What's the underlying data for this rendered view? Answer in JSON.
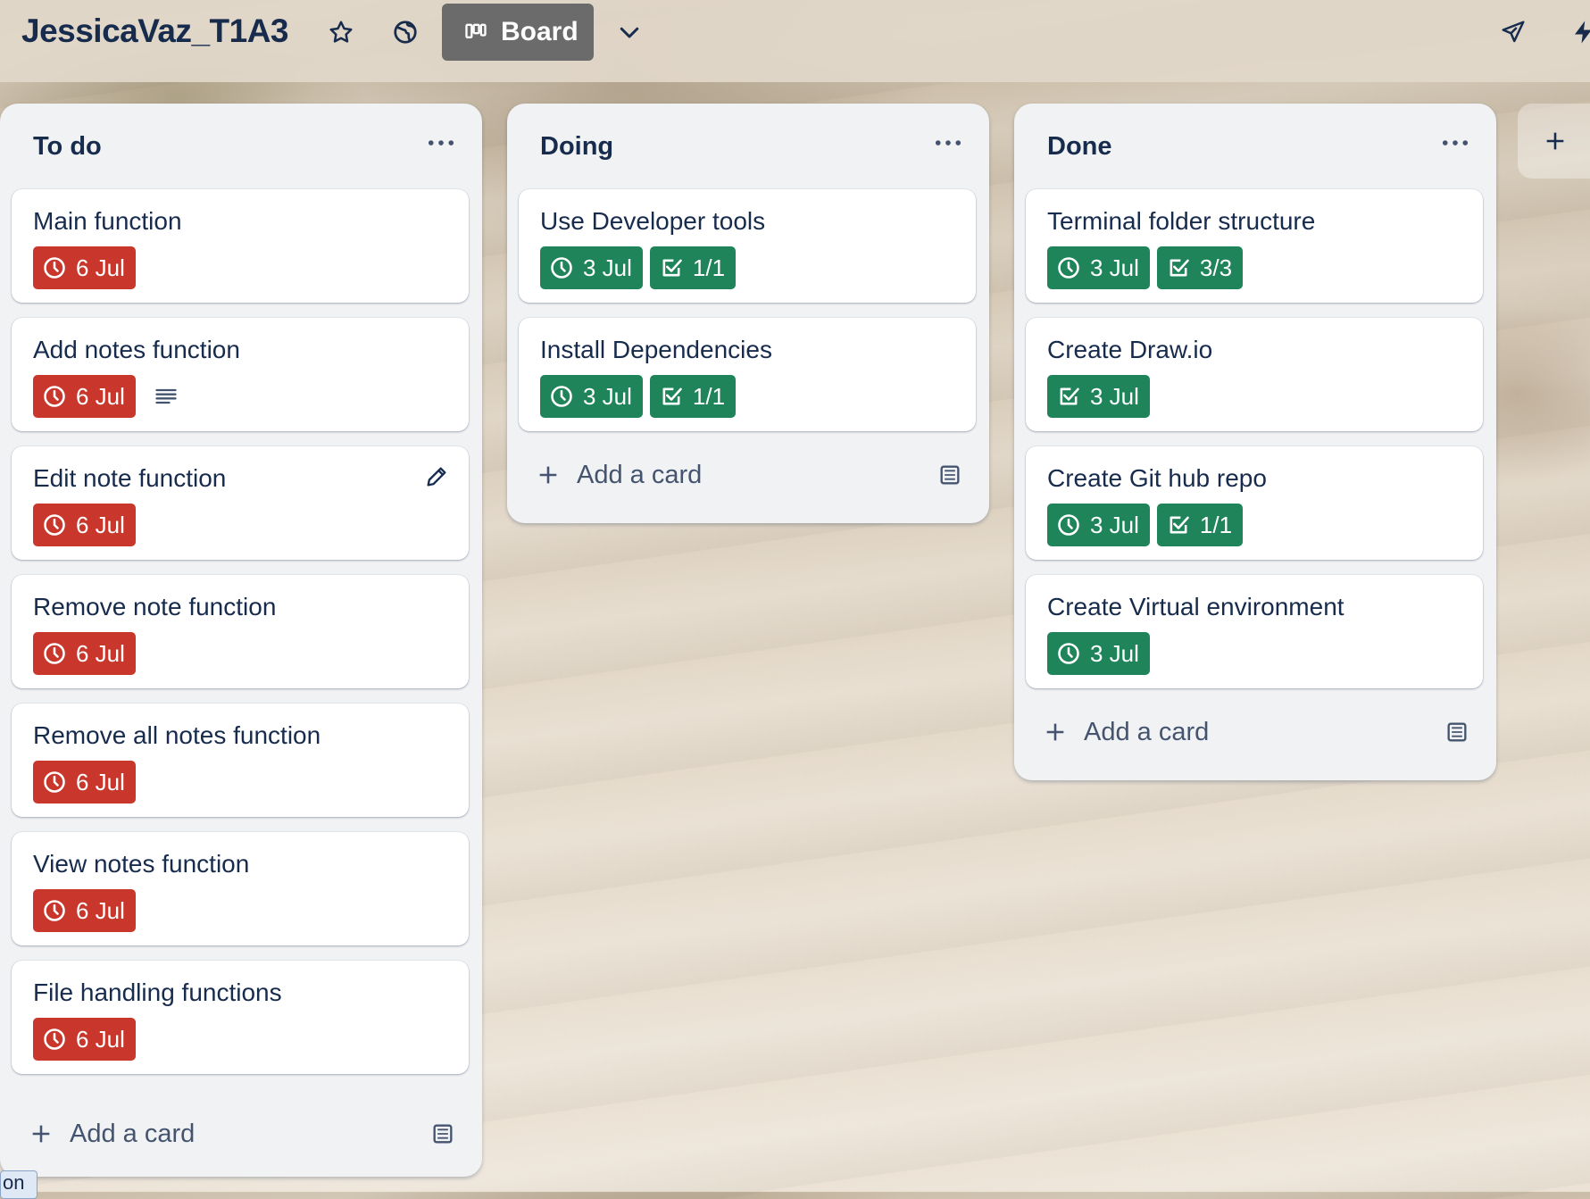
{
  "header": {
    "board_title": "JessicaVaz_T1A3",
    "view_label": "Board",
    "icons": [
      "star-icon",
      "globe-icon",
      "board-icon",
      "chevron-down-icon",
      "rocket-icon",
      "lightning-icon"
    ]
  },
  "colors": {
    "overdue": "#c9372c",
    "complete": "#1f845a",
    "list_bg": "#f1f2f4"
  },
  "lists": [
    {
      "title": "To do",
      "add_label": "Add a card",
      "cards": [
        {
          "title": "Main function",
          "due": "6 Jul"
        },
        {
          "title": "Add notes function",
          "due": "6 Jul"
        },
        {
          "title": "Edit note function",
          "due": "6 Jul"
        },
        {
          "title": "Remove note function",
          "due": "6 Jul"
        },
        {
          "title": "Remove all notes function",
          "due": "6 Jul"
        },
        {
          "title": "View notes function",
          "due": "6 Jul"
        },
        {
          "title": "File handling functions",
          "due": "6 Jul"
        }
      ]
    },
    {
      "title": "Doing",
      "add_label": "Add a card",
      "cards": [
        {
          "title": "Use Developer tools",
          "due": "3 Jul",
          "checklist": "1/1"
        },
        {
          "title": "Install Dependencies",
          "due": "3 Jul",
          "checklist": "1/1"
        }
      ]
    },
    {
      "title": "Done",
      "add_label": "Add a card",
      "cards": [
        {
          "title": "Terminal folder structure",
          "due": "3 Jul",
          "checklist": "3/3"
        },
        {
          "title": "Create Draw.io",
          "due": "3 Jul"
        },
        {
          "title": "Create Git hub repo",
          "due": "3 Jul",
          "checklist": "1/1"
        },
        {
          "title": "Create Virtual environment",
          "due": "3 Jul"
        }
      ]
    }
  ],
  "tooltip_text": "on"
}
